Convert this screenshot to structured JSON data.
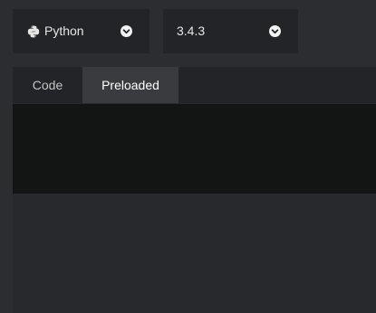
{
  "language_selector": {
    "label": "Python",
    "icon": "python-logo-icon",
    "dropdown_icon": "chevron-down-circle-icon"
  },
  "version_selector": {
    "label": "3.4.3",
    "dropdown_icon": "chevron-down-circle-icon"
  },
  "tabs": [
    {
      "label": "Code",
      "active": false
    },
    {
      "label": "Preloaded",
      "active": true
    }
  ],
  "editor": {
    "content": ""
  },
  "colors": {
    "page_bg": "#2c2d30",
    "dropdown_bg": "#232427",
    "active_tab_bg": "#3a3b3e",
    "editor_bg": "#131514",
    "text": "#e6e6e6"
  }
}
